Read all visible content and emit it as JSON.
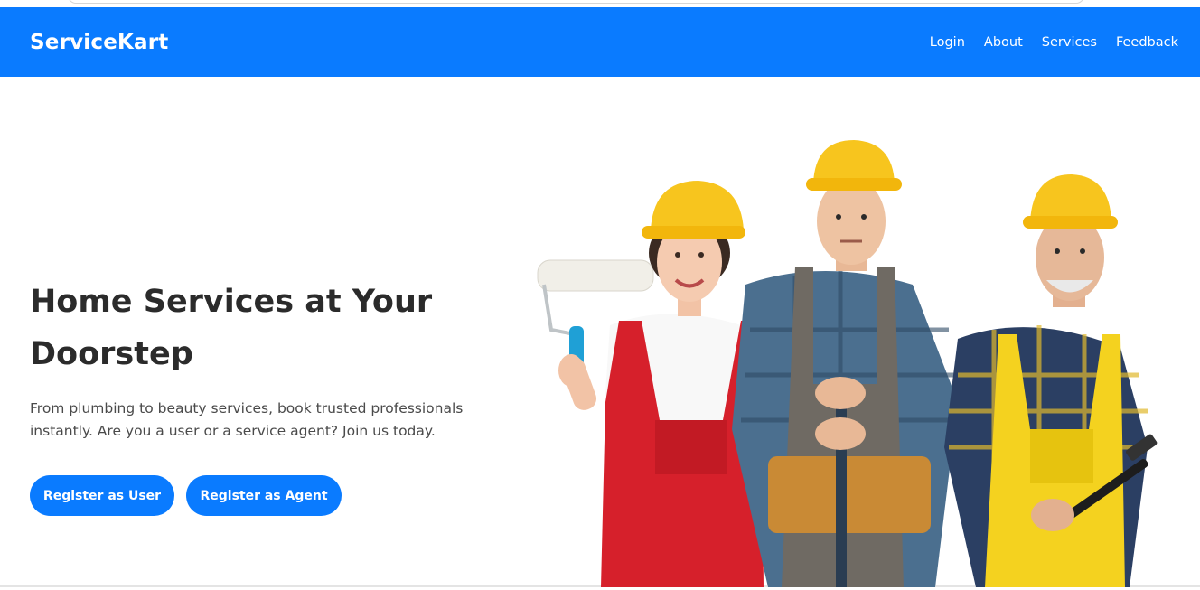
{
  "header": {
    "brand": "ServiceKart",
    "nav": [
      "Login",
      "About",
      "Services",
      "Feedback"
    ]
  },
  "hero": {
    "title": "Home Services at Your Doorstep",
    "subtitle": "From plumbing to beauty services, book trusted professionals instantly. Are you a user or a service agent? Join us today.",
    "buttons": {
      "user": "Register as User",
      "agent": "Register as Agent"
    }
  },
  "colors": {
    "primary": "#0a7bff",
    "heading": "#2b2b2b",
    "body_text": "#4a4a4a",
    "hard_hat": "#f7c51e"
  }
}
